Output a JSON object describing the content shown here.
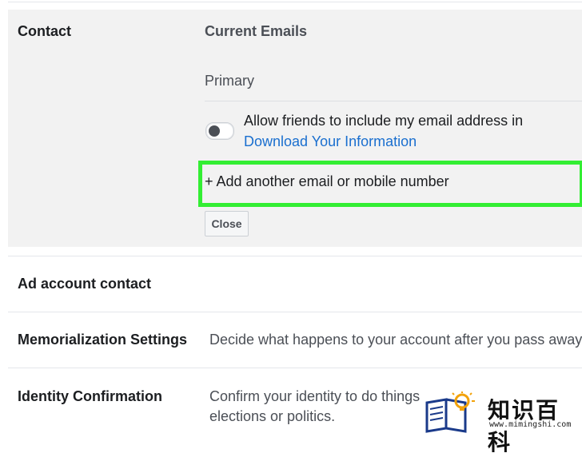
{
  "contact": {
    "title": "Contact",
    "current_emails": "Current Emails",
    "primary": "Primary",
    "allow_text": "Allow friends to include my email address in",
    "download_link": "Download Your Information",
    "add_email": "+ Add another email or mobile number",
    "close_label": "Close"
  },
  "rows": [
    {
      "title": "Ad account contact",
      "desc": ""
    },
    {
      "title": "Memorialization Settings",
      "desc": "Decide what happens to your account after you pass away."
    },
    {
      "title": "Identity Confirmation",
      "desc_line1": "Confirm your identity to do things",
      "desc_line2": "elections or politics."
    }
  ],
  "watermark": {
    "text": "知识百科",
    "url": "www.mimingshi.com"
  },
  "colors": {
    "highlight": "#33ee33",
    "link": "#1a6fcf",
    "section_bg": "#f2f2f2"
  }
}
